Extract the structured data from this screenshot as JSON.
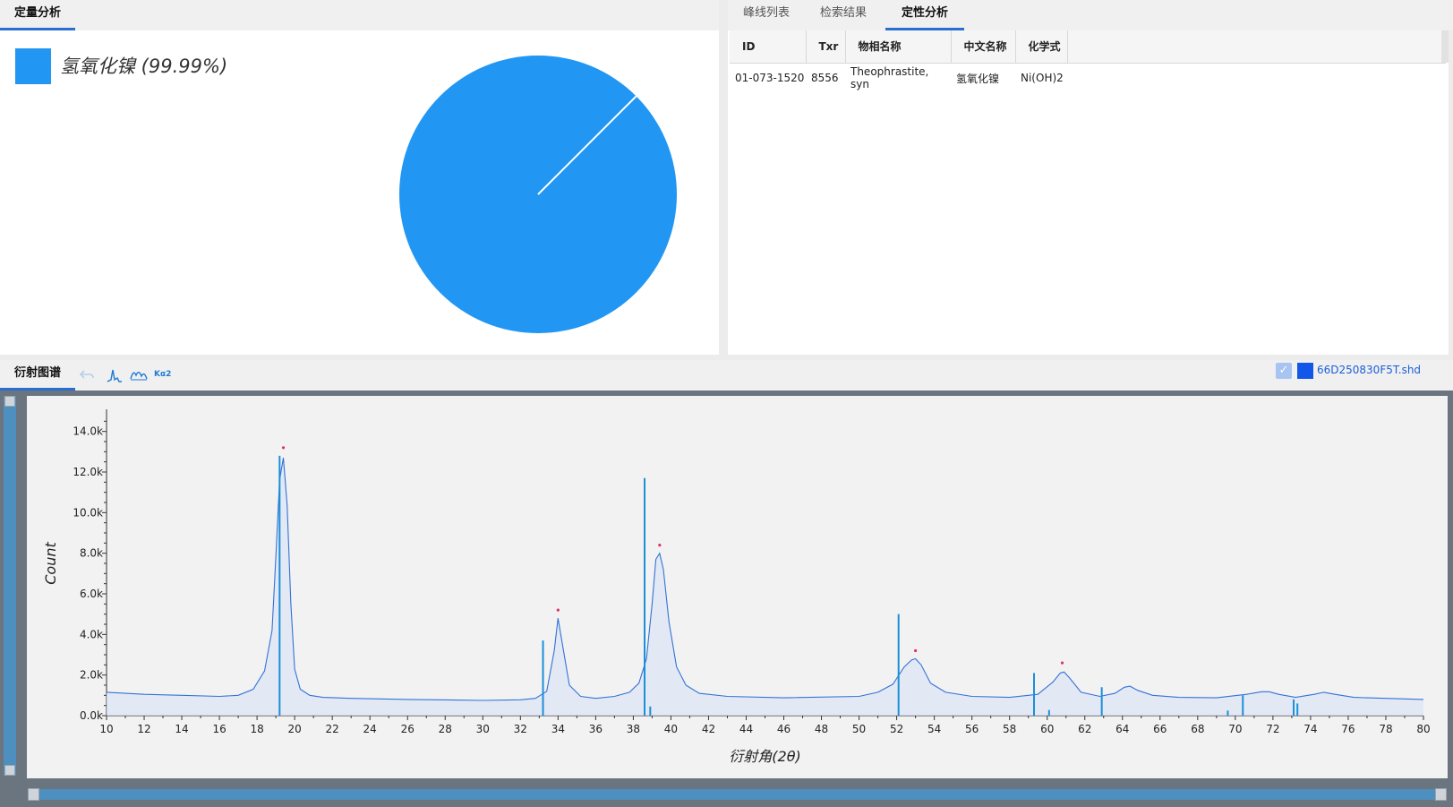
{
  "quant": {
    "tab_label": "定量分析",
    "legend_label": "氢氧化镍 (99.99%)",
    "color": "#2196f3"
  },
  "qual": {
    "tabs": [
      {
        "label": "峰线列表",
        "active": false
      },
      {
        "label": "检索结果",
        "active": false
      },
      {
        "label": "定性分析",
        "active": true
      }
    ],
    "columns": [
      "ID",
      "Txr",
      "物相名称",
      "中文名称",
      "化学式"
    ],
    "rows": [
      [
        "01-073-1520",
        "8556",
        "Theophrastite, syn",
        "氢氧化镍",
        "Ni(OH)2"
      ]
    ]
  },
  "diffraction": {
    "tab_label": "衍射图谱",
    "ka2_label": "Kα2",
    "file_name": "66D250830F5T.shd",
    "file_color": "#1357e8",
    "trace_color": "#3272d8",
    "stick_color": "#1b8fd8",
    "marker_color": "#e0306a"
  },
  "chart_data": {
    "type": "line",
    "xlabel": "衍射角(2θ)",
    "ylabel": "Count",
    "xlim": [
      10,
      80
    ],
    "ylim": [
      0,
      15000
    ],
    "x_ticks": [
      10,
      12,
      14,
      16,
      18,
      20,
      22,
      24,
      26,
      28,
      30,
      32,
      34,
      36,
      38,
      40,
      42,
      44,
      46,
      48,
      50,
      52,
      54,
      56,
      58,
      60,
      62,
      64,
      66,
      68,
      70,
      72,
      74,
      76,
      78,
      80
    ],
    "y_tick_labels": [
      "0.0k",
      "2.0k",
      "4.0k",
      "6.0k",
      "8.0k",
      "10.0k",
      "12.0k",
      "14.0k"
    ],
    "y_ticks": [
      0,
      2000,
      4000,
      6000,
      8000,
      10000,
      12000,
      14000
    ],
    "series": [
      {
        "x": [
          10,
          12,
          14,
          16,
          17,
          17.8,
          18.4,
          18.8,
          19.0,
          19.2,
          19.4,
          19.6,
          19.8,
          20.0,
          20.3,
          20.8,
          21.5,
          23,
          26,
          30,
          32,
          32.8,
          33.4,
          33.8,
          34.0,
          34.2,
          34.6,
          35.2,
          36,
          37,
          37.8,
          38.3,
          38.7,
          39.0,
          39.2,
          39.4,
          39.6,
          39.9,
          40.3,
          40.8,
          41.5,
          43,
          46,
          50,
          51,
          51.8,
          52.4,
          52.8,
          53.0,
          53.3,
          53.8,
          54.6,
          56,
          58,
          59.5,
          60.3,
          60.7,
          60.9,
          61.2,
          61.8,
          62.8,
          63.6,
          64.1,
          64.4,
          64.8,
          65.6,
          67,
          69,
          70.6,
          71.4,
          71.8,
          72.3,
          73.2,
          74.2,
          74.7,
          75.3,
          76.3,
          78,
          80
        ],
        "y": [
          1150,
          1050,
          1000,
          950,
          1000,
          1300,
          2200,
          4200,
          7800,
          11600,
          12700,
          10400,
          5500,
          2300,
          1300,
          1000,
          900,
          850,
          800,
          750,
          780,
          850,
          1200,
          3200,
          4800,
          3700,
          1500,
          950,
          850,
          950,
          1150,
          1600,
          2800,
          5500,
          7700,
          8000,
          7200,
          4600,
          2400,
          1500,
          1100,
          950,
          880,
          950,
          1150,
          1550,
          2400,
          2750,
          2800,
          2500,
          1600,
          1150,
          950,
          900,
          1050,
          1650,
          2100,
          2150,
          1850,
          1150,
          950,
          1100,
          1400,
          1450,
          1250,
          1000,
          900,
          880,
          1050,
          1180,
          1180,
          1050,
          900,
          1050,
          1150,
          1050,
          900,
          850,
          800
        ]
      }
    ],
    "reference_sticks": [
      {
        "x": 19.2,
        "y": 12800
      },
      {
        "x": 33.2,
        "y": 3700
      },
      {
        "x": 38.6,
        "y": 11700
      },
      {
        "x": 38.9,
        "y": 450
      },
      {
        "x": 52.1,
        "y": 5000
      },
      {
        "x": 59.3,
        "y": 2100
      },
      {
        "x": 60.1,
        "y": 280
      },
      {
        "x": 62.9,
        "y": 1400
      },
      {
        "x": 69.6,
        "y": 250
      },
      {
        "x": 70.4,
        "y": 1000
      },
      {
        "x": 73.1,
        "y": 800
      },
      {
        "x": 73.3,
        "y": 600
      }
    ],
    "peak_markers": [
      {
        "x": 19.4,
        "y": 13200
      },
      {
        "x": 34.0,
        "y": 5200
      },
      {
        "x": 39.4,
        "y": 8400
      },
      {
        "x": 53.0,
        "y": 3200
      },
      {
        "x": 60.8,
        "y": 2600
      }
    ],
    "pie": {
      "slices": [
        {
          "label": "氢氧化镍",
          "value": 99.99
        }
      ]
    }
  }
}
